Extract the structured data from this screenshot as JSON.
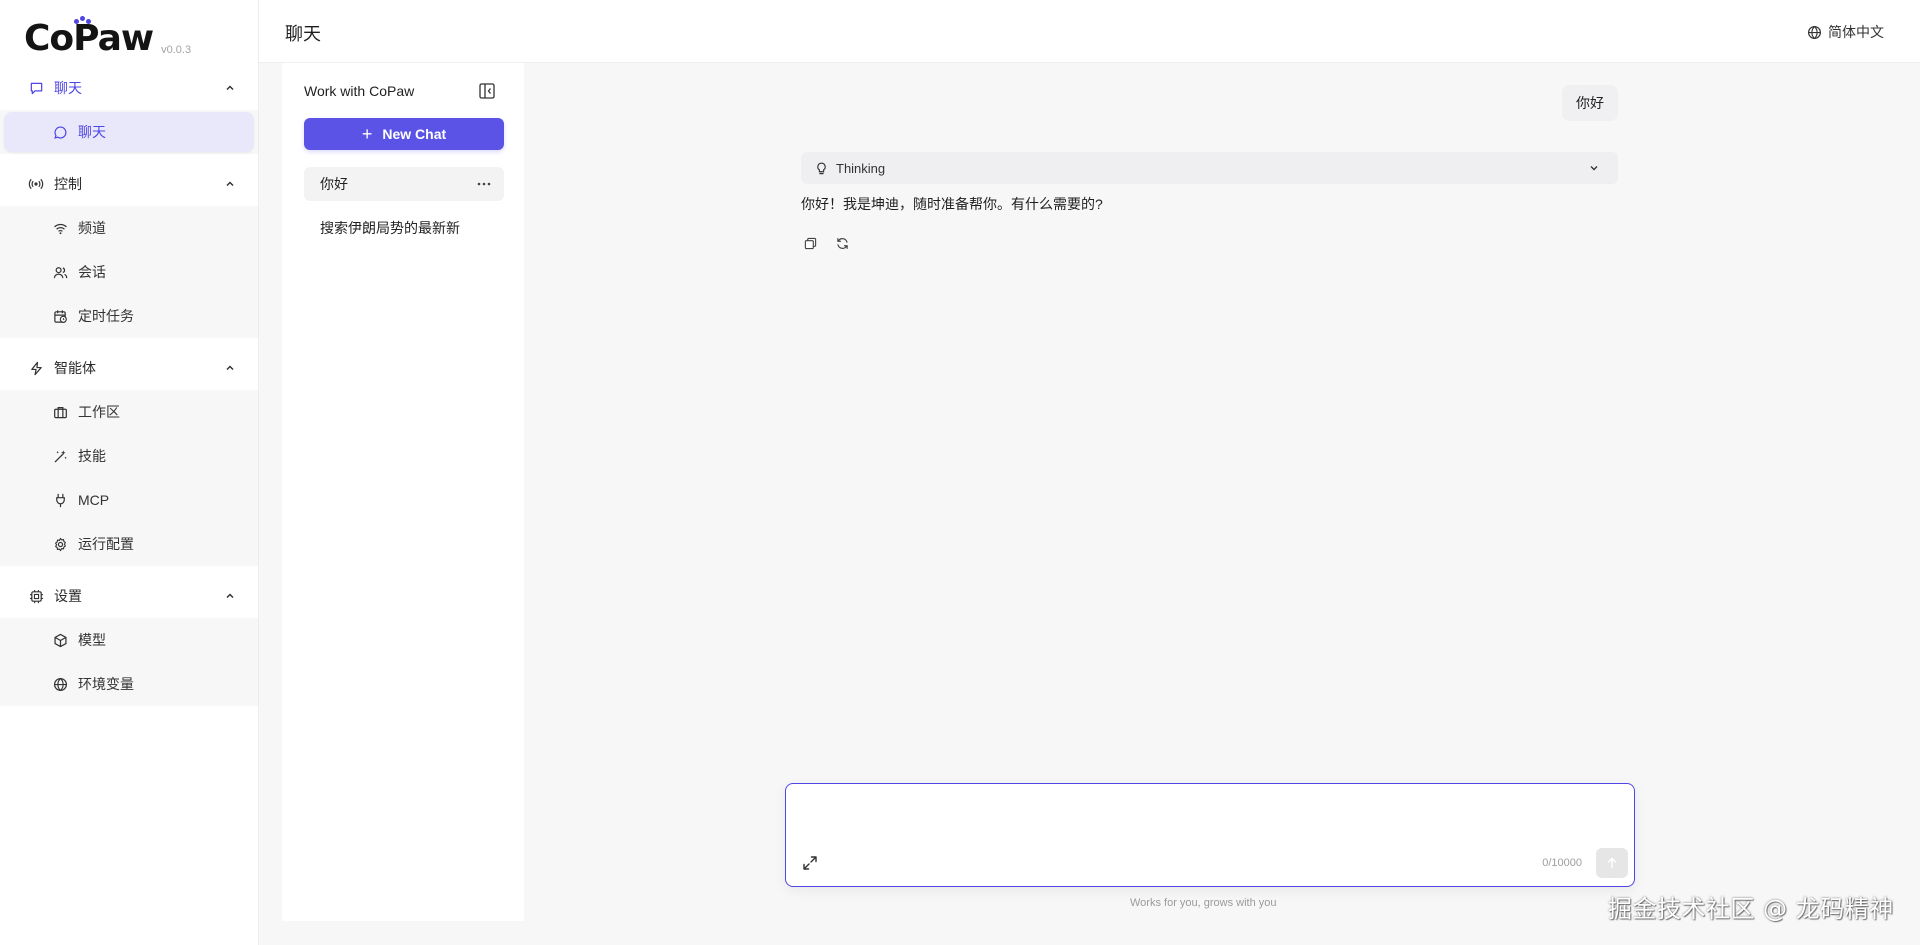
{
  "app": {
    "logo_text": "CoPaw",
    "version": "v0.0.3"
  },
  "header": {
    "title": "聊天",
    "language": "简体中文",
    "language_icon": "globe-icon"
  },
  "sidebar": {
    "groups": [
      {
        "label": "聊天",
        "icon": "chat-bubble-icon",
        "expanded": true,
        "items": [
          {
            "label": "聊天",
            "icon": "chat-circle-icon",
            "selected": true
          }
        ]
      },
      {
        "label": "控制",
        "icon": "broadcast-icon",
        "expanded": true,
        "items": [
          {
            "label": "频道",
            "icon": "wifi-icon"
          },
          {
            "label": "会话",
            "icon": "users-icon"
          },
          {
            "label": "定时任务",
            "icon": "calendar-clock-icon"
          }
        ]
      },
      {
        "label": "智能体",
        "icon": "lightning-icon",
        "expanded": true,
        "items": [
          {
            "label": "工作区",
            "icon": "briefcase-icon"
          },
          {
            "label": "技能",
            "icon": "sparkles-icon"
          },
          {
            "label": "MCP",
            "icon": "plug-icon"
          },
          {
            "label": "运行配置",
            "icon": "gear-icon"
          }
        ]
      },
      {
        "label": "设置",
        "icon": "chip-icon",
        "expanded": true,
        "items": [
          {
            "label": "模型",
            "icon": "cube-icon"
          },
          {
            "label": "环境变量",
            "icon": "globe-icon"
          }
        ]
      }
    ]
  },
  "chat_panel": {
    "title": "Work with CoPaw",
    "new_chat_label": "New Chat",
    "sessions": [
      {
        "title": "你好",
        "active": true
      },
      {
        "title": "搜索伊朗局势的最新新",
        "active": false
      }
    ]
  },
  "conversation": {
    "user_message": "你好",
    "thinking_label": "Thinking",
    "assistant_reply": "你好！我是坤迪，随时准备帮你。有什么需要的?"
  },
  "composer": {
    "placeholder": "",
    "value": "",
    "counter": "0/10000",
    "footer_note": "Works for you, grows with you"
  },
  "watermark": "掘金技术社区 @ 龙码精神",
  "colors": {
    "accent": "#4f46e5",
    "accent_button": "#5b53e6",
    "selected_bg": "#e9e8fb"
  }
}
